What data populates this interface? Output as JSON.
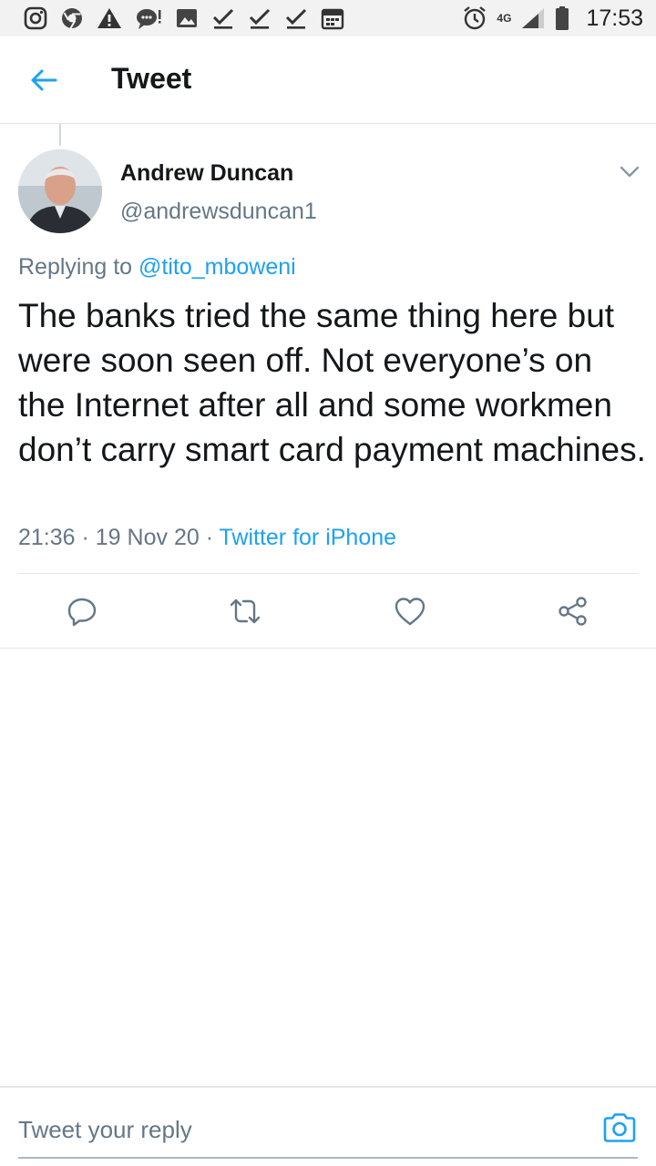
{
  "status_bar": {
    "time": "17:53",
    "network": "4G",
    "icons": [
      "instagram-icon",
      "chrome-icon",
      "warning-icon",
      "chat-icon",
      "image-icon",
      "check-icon",
      "check-icon",
      "check-icon",
      "calendar-icon",
      "alarm-icon",
      "network-icon",
      "signal-icon",
      "battery-icon"
    ]
  },
  "header": {
    "title": "Tweet",
    "back_icon": "arrow-left-icon"
  },
  "tweet": {
    "author_name": "Andrew Duncan",
    "author_handle": "@andrewsduncan1",
    "replying_prefix": "Replying to ",
    "replying_to": "@tito_mboweni",
    "text": "The banks tried the same thing here but were soon seen off. Not everyone’s on the Internet after all and some workmen don’t carry smart card payment machines.",
    "time": "21:36",
    "date": "19 Nov 20",
    "separator": " · ",
    "source": "Twitter for iPhone"
  },
  "actions": [
    {
      "name": "reply",
      "icon": "reply-icon"
    },
    {
      "name": "retweet",
      "icon": "retweet-icon"
    },
    {
      "name": "like",
      "icon": "heart-icon"
    },
    {
      "name": "share",
      "icon": "share-icon"
    }
  ],
  "composer": {
    "placeholder": "Tweet your reply",
    "camera_icon": "camera-icon"
  },
  "colors": {
    "accent": "#1da1f2",
    "secondary_text": "#657786",
    "primary_text": "#14171a",
    "divider": "#e1e6ea",
    "status_bar_bg": "#f2f2f2"
  }
}
